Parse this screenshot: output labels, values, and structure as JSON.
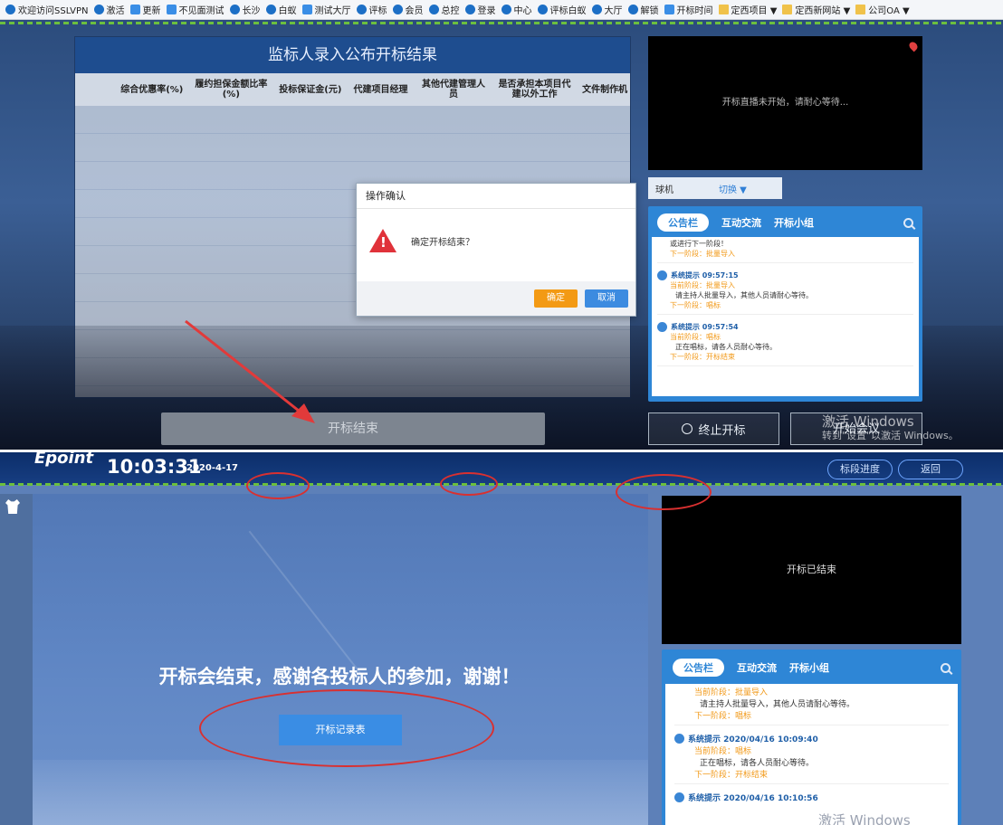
{
  "bookmarks": [
    {
      "label": "欢迎访问SSLVPN",
      "icon": "ie-icon"
    },
    {
      "label": "激活",
      "icon": "ie-icon"
    },
    {
      "label": "更新",
      "icon": "page-icon"
    },
    {
      "label": "不见面测试",
      "icon": "page-icon"
    },
    {
      "label": "长沙",
      "icon": "ie-icon"
    },
    {
      "label": "白蚁",
      "icon": "ie-icon"
    },
    {
      "label": "测试大厅",
      "icon": "page-icon"
    },
    {
      "label": "评标",
      "icon": "ie-icon"
    },
    {
      "label": "会员",
      "icon": "ie-icon"
    },
    {
      "label": "总控",
      "icon": "ie-icon"
    },
    {
      "label": "登录",
      "icon": "ie-icon"
    },
    {
      "label": "中心",
      "icon": "ie-icon"
    },
    {
      "label": "评标白蚁",
      "icon": "ie-icon"
    },
    {
      "label": "大厅",
      "icon": "ie-icon"
    },
    {
      "label": "解锁",
      "icon": "ie-icon"
    },
    {
      "label": "开标时间",
      "icon": "page-icon"
    },
    {
      "label": "定西项目 ▼",
      "icon": "folder-icon"
    },
    {
      "label": "定西新网站 ▼",
      "icon": "folder-icon"
    },
    {
      "label": "公司OA ▼",
      "icon": "folder-icon"
    }
  ],
  "top": {
    "panel_title": "监标人录入公布开标结果",
    "columns": [
      "综合优惠率(%)",
      "履约担保金额比率(%)",
      "投标保证金(元)",
      "代建项目经理",
      "其他代建管理人员",
      "是否承担本项目代建以外工作",
      "文件制作机"
    ],
    "end_button": "开标结束",
    "video_status": "开标直播未开始，请耐心等待...",
    "camera_label": "球机",
    "camera_switch": "切换 ▼",
    "tabs": [
      "公告栏",
      "互动交流",
      "开标小组"
    ],
    "messages": [
      {
        "who": "",
        "stage": "",
        "body": "或进行下一阶段！",
        "next": "下一阶段：批量导入"
      },
      {
        "who": "系统提示 09:57:15",
        "stage": "当前阶段：批量导入",
        "body": "请主持人批量导入，其他人员请耐心等待。",
        "next": "下一阶段：唱标"
      },
      {
        "who": "系统提示 09:57:54",
        "stage": "当前阶段：唱标",
        "body": "正在唱标，请各人员耐心等待。",
        "next": "下一阶段：开标结束"
      }
    ],
    "stop_button": "终止开标",
    "meeting_button": "开始会议",
    "watermark_title": "激活 Windows",
    "watermark_sub": "转到\"设置\"以激活 Windows。",
    "dialog": {
      "title": "操作确认",
      "message": "确定开标结束？",
      "ok": "确定",
      "cancel": "取消"
    }
  },
  "bottom": {
    "logo": "Epoint",
    "time": "10:03:31",
    "date": "2020-4-17",
    "progress_button": "标段进度",
    "back_button": "返回",
    "thanks": "开标会结束，感谢各投标人的参加，谢谢！",
    "record_button": "开标记录表",
    "video_status": "开标已结束",
    "tabs": [
      "公告栏",
      "互动交流",
      "开标小组"
    ],
    "messages": [
      {
        "who": "",
        "stage": "当前阶段：批量导入",
        "body": "请主持人批量导入，其他人员请耐心等待。",
        "next": "下一阶段：唱标"
      },
      {
        "who": "系统提示 2020/04/16 10:09:40",
        "stage": "当前阶段：唱标",
        "body": "正在唱标，请各人员耐心等待。",
        "next": "下一阶段：开标结束"
      },
      {
        "who": "系统提示 2020/04/16 10:10:56",
        "stage": "",
        "body": "",
        "next": ""
      }
    ],
    "watermark": "激活 Windows"
  }
}
